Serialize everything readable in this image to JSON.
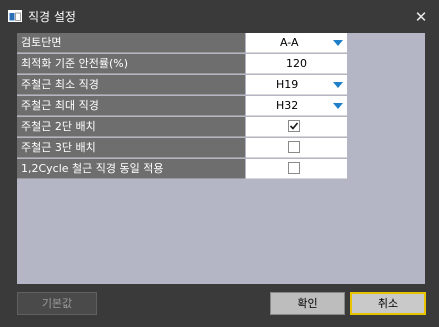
{
  "window": {
    "title": "직경 설정",
    "close_icon": "close-icon"
  },
  "rows": [
    {
      "label": "검토단면",
      "value": "A-A",
      "type": "combo"
    },
    {
      "label": "최적화 기준 안전률(%)",
      "value": "120",
      "type": "number"
    },
    {
      "label": "주철근 최소 직경",
      "value": "H19",
      "type": "combo"
    },
    {
      "label": "주철근 최대 직경",
      "value": "H32",
      "type": "combo"
    },
    {
      "label": "주철근 2단 배치",
      "checked": true,
      "type": "check"
    },
    {
      "label": "주철근 3단 배치",
      "checked": false,
      "type": "check"
    },
    {
      "label": "1,2Cycle 철근 직경 동일 적용",
      "checked": false,
      "type": "check"
    }
  ],
  "buttons": {
    "default": "기본값",
    "ok": "확인",
    "cancel": "취소"
  },
  "colors": {
    "accent_arrow": "#1f7fc8",
    "cancel_border": "#e8c300",
    "panel": "#b4b6c6"
  }
}
